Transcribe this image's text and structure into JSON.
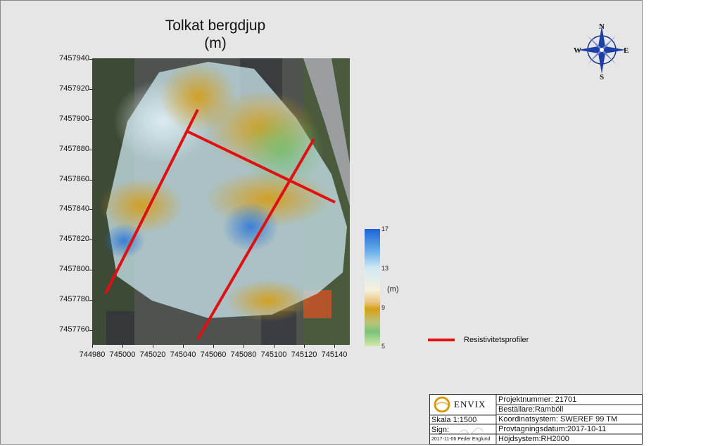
{
  "title": {
    "line1": "Tolkat bergdjup",
    "line2": "(m)"
  },
  "map": {
    "axes": {
      "y_ticks": [
        "7457940",
        "7457920",
        "7457900",
        "7457880",
        "7457860",
        "7457840",
        "7457820",
        "7457800",
        "7457780",
        "7457760"
      ],
      "x_ticks": [
        "744980",
        "745000",
        "745020",
        "745040",
        "745060",
        "745080",
        "745100",
        "745120",
        "745140"
      ]
    }
  },
  "colorbar": {
    "ticks": [
      "17",
      "13",
      "9",
      "5"
    ],
    "unit": "(m)",
    "colors": [
      "#1a64d6",
      "#cfe8f4",
      "#f7f1de",
      "#d8a015",
      "#7ac47a",
      "#d7e9a8"
    ]
  },
  "legend": {
    "label": "Resistivitetsprofiler",
    "color": "#e01010"
  },
  "compass": {
    "n": "N",
    "s": "S",
    "e": "E",
    "w": "W"
  },
  "title_block": {
    "logo": "ENVIX",
    "project": "Projektnummer: 21701",
    "client": "Beställare:Ramböll",
    "scale": "Skala 1:1500",
    "coord": "Koordinatsystem: SWEREF 99 TM",
    "sign": "Sign:",
    "date_sampling": "Provtagningsdatum:2017-10-11",
    "date_author": "2017-11-06  Peder Englund",
    "height_system": "Höjdsystem:RH2000"
  }
}
